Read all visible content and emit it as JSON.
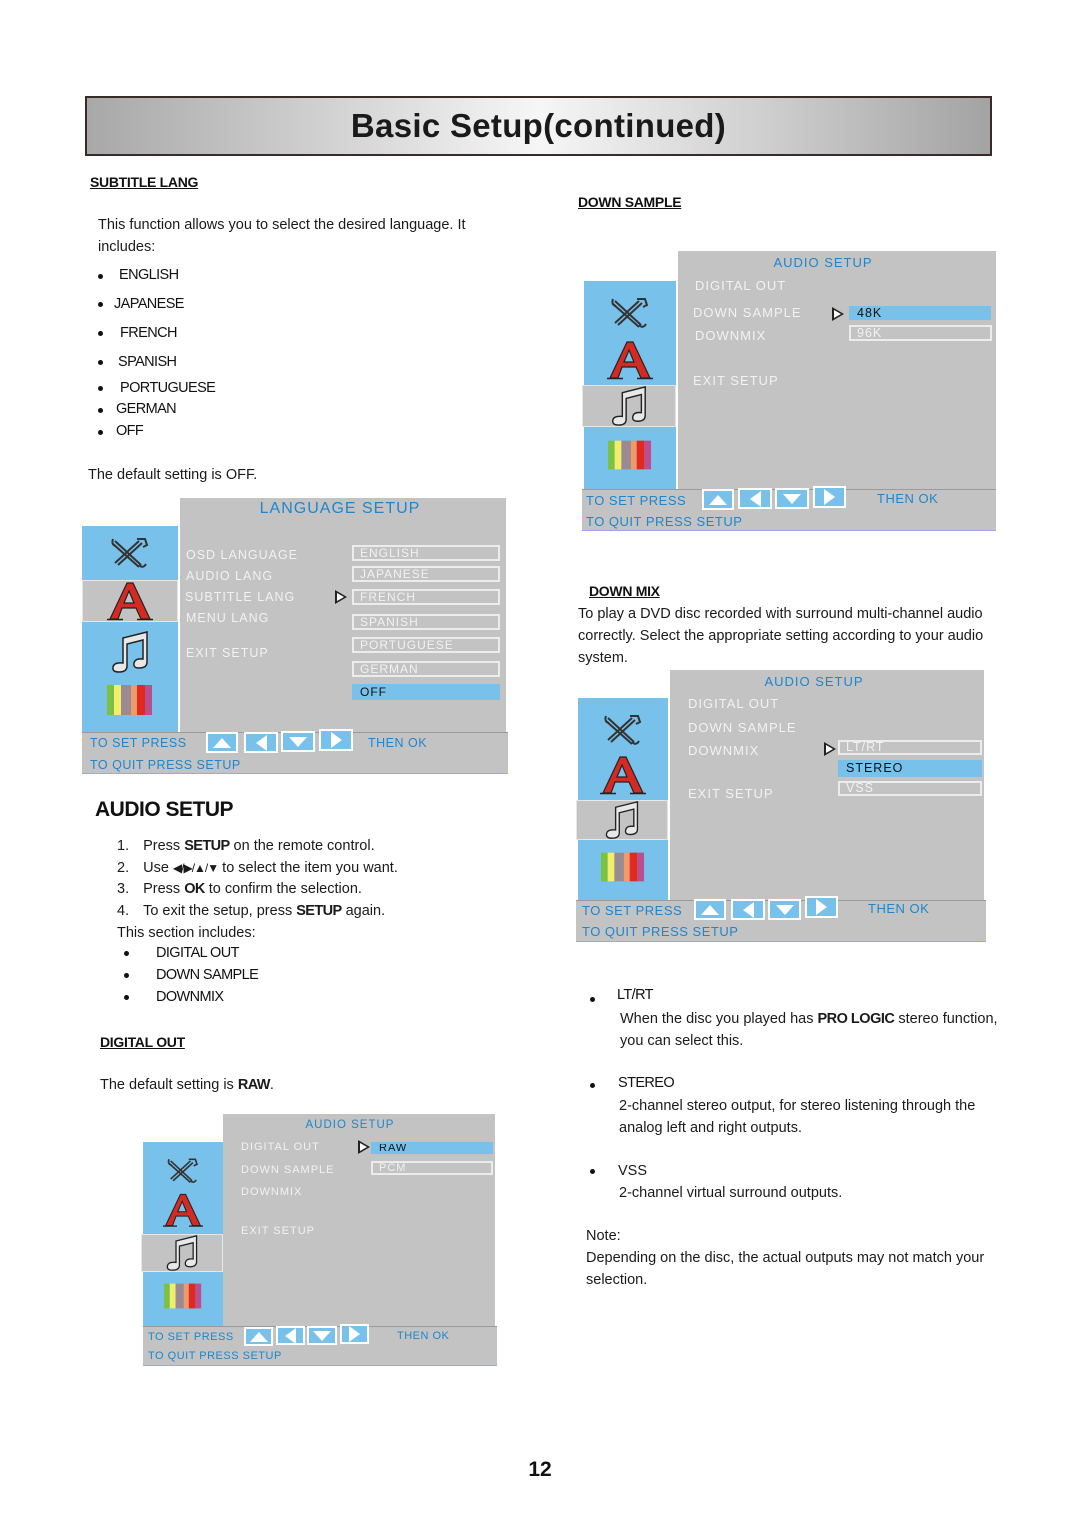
{
  "page": {
    "title": "Basic Setup(continued)",
    "page_number": "12"
  },
  "subtitle_lang": {
    "heading": "SUBTITLE LANG",
    "intro_line1": "This function allows you to select the desired language.   It",
    "intro_line2": "includes:",
    "items": [
      "ENGLISH",
      "JAPANESE",
      "FRENCH",
      "SPANISH",
      "PORTUGUESE",
      "GERMAN",
      "OFF"
    ],
    "default_text": "The default setting is OFF."
  },
  "language_osd": {
    "title": "LANGUAGE SETUP",
    "menu_items": [
      "OSD LANGUAGE",
      "AUDIO LANG",
      "SUBTITLE LANG",
      "MENU LANG",
      "EXIT SETUP"
    ],
    "options": [
      "ENGLISH",
      "JAPANESE",
      "FRENCH",
      "SPANISH",
      "PORTUGUESE",
      "GERMAN",
      "OFF"
    ],
    "selected_option": "OFF",
    "cursor_on": "SUBTITLE LANG",
    "footer_set": "TO SET PRESS",
    "footer_then": "THEN OK",
    "footer_quit": "TO QUIT PRESS SETUP",
    "sidebar_icons": [
      "tools-icon",
      "language-a-icon",
      "music-note-icon",
      "color-bars-icon"
    ],
    "active_sidebar": "language-a-icon"
  },
  "audio_setup": {
    "heading": "AUDIO SETUP",
    "steps": [
      {
        "num": "1.",
        "pre": "Press ",
        "bold": "SETUP",
        "post": " on the remote control."
      },
      {
        "num": "2.",
        "pre": "Use ",
        "arrows": "◀/▶/▲/▼",
        "post": " to select the item you want."
      },
      {
        "num": "3.",
        "pre": "Press ",
        "bold": "OK",
        "post": " to confirm the selection."
      },
      {
        "num": "4.",
        "pre": "To exit the setup, press ",
        "bold": "SETUP",
        "post": " again."
      }
    ],
    "includes_label": "This section includes:",
    "includes": [
      "DIGITAL OUT",
      "DOWN SAMPLE",
      "DOWNMIX"
    ]
  },
  "digital_out": {
    "heading": "DIGITAL OUT",
    "default_pre": "The default setting is ",
    "default_bold": "RAW",
    "default_post": "."
  },
  "audio_osd_common": {
    "title": "AUDIO SETUP",
    "menu_items": [
      "DIGITAL OUT",
      "DOWN SAMPLE",
      "DOWNMIX",
      "EXIT SETUP"
    ],
    "footer_set": "TO SET PRESS",
    "footer_then": "THEN OK",
    "footer_quit": "TO QUIT PRESS SETUP",
    "active_sidebar": "music-note-icon"
  },
  "digital_out_osd": {
    "options": [
      "RAW",
      "PCM"
    ],
    "selected_option": "RAW",
    "cursor_on": "DIGITAL OUT"
  },
  "down_sample": {
    "heading": "DOWN SAMPLE"
  },
  "down_sample_osd": {
    "options": [
      "48K",
      "96K"
    ],
    "selected_option": "48K",
    "cursor_on": "DOWN SAMPLE"
  },
  "down_mix": {
    "heading": "DOWN MIX",
    "para_line1": "To play a DVD  disc recorded with surround multi-channel audio",
    "para_line2": "correctly.  Select the appropriate setting according to your audio",
    "para_line3": "system.",
    "entries": [
      {
        "label": "LT/RT",
        "line1_pre": "When the disc you played has ",
        "line1_bold": "PRO LOGIC",
        "line1_post": " stereo function,",
        "line2": "you can select this."
      },
      {
        "label": "STEREO",
        "line1_pre": "2-channel stereo output, for stereo listening through the",
        "line1_bold": "",
        "line1_post": "",
        "line2": "analog left and right outputs."
      },
      {
        "label": "VSS",
        "line1_pre": "2-channel virtual surround outputs.",
        "line1_bold": "",
        "line1_post": "",
        "line2": ""
      }
    ],
    "note_label": "Note:",
    "note_line1": "Depending on the disc, the actual outputs may not  match your",
    "note_line2": "selection."
  },
  "down_mix_osd": {
    "options": [
      "LT/RT",
      "STEREO",
      "VSS"
    ],
    "selected_option": "STEREO",
    "cursor_on": "DOWNMIX"
  },
  "colors": {
    "osd_blue": "#78c1ea",
    "osd_gray": "#c3c3c3",
    "osd_title": "#1e86cc",
    "a_icon_red": "#d42a22"
  }
}
